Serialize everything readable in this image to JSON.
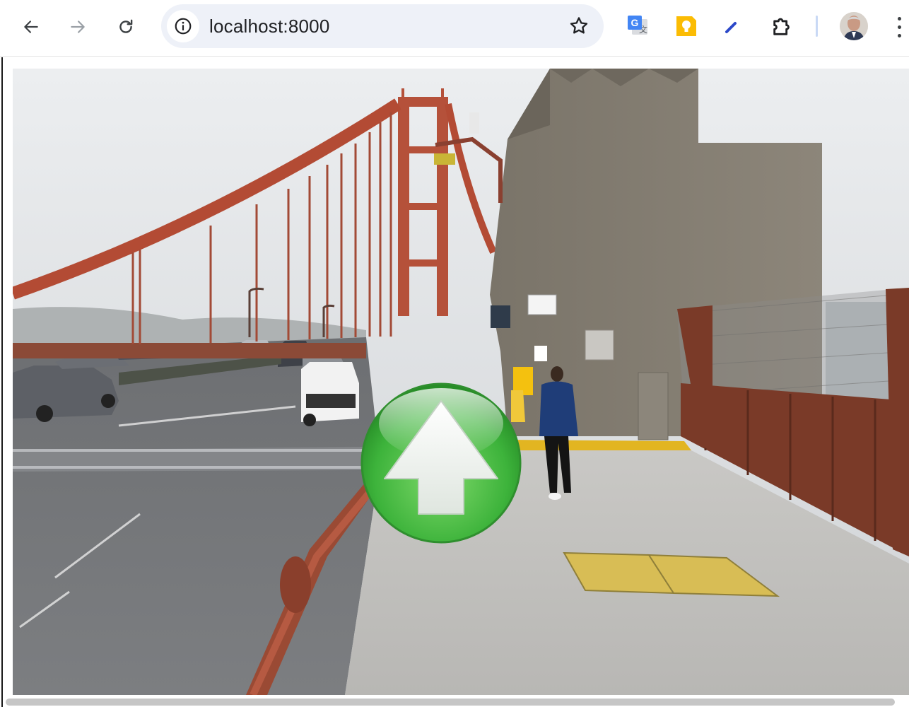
{
  "browser": {
    "url": "localhost:8000",
    "back_icon": "arrow-left-icon",
    "forward_icon": "arrow-right-icon",
    "reload_icon": "reload-icon",
    "site_info_icon": "info-icon",
    "bookmark_icon": "star-icon",
    "extensions": [
      {
        "name": "google-translate-extension",
        "icon": "translate-icon"
      },
      {
        "name": "google-keep-extension",
        "icon": "keep-bulb-icon"
      },
      {
        "name": "pen-extension",
        "icon": "pen-icon"
      },
      {
        "name": "extensions-puzzle",
        "icon": "puzzle-icon"
      }
    ],
    "menu_icon": "kebab-menu-icon"
  },
  "viewer": {
    "scene": "street-view-panorama",
    "navigation_control": "forward-arrow"
  },
  "colors": {
    "accent_green": "#3db33b",
    "bridge_red": "#b5513a",
    "toolbar_bg": "#ffffff",
    "omnibox_bg": "#eef1f8"
  }
}
